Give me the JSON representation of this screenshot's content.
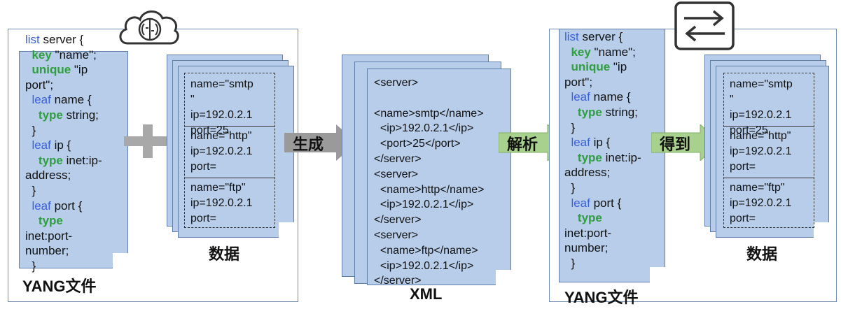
{
  "left_yang": {
    "lines": [
      [
        {
          "t": "list",
          "c": "blue"
        },
        {
          "t": " server {",
          "c": ""
        }
      ],
      [
        {
          "t": "  ",
          "c": ""
        },
        {
          "t": "key",
          "c": "green"
        },
        {
          "t": " \"name\";",
          "c": ""
        }
      ],
      [
        {
          "t": "  ",
          "c": ""
        },
        {
          "t": "unique",
          "c": "green"
        },
        {
          "t": " \"ip",
          "c": ""
        }
      ],
      [
        {
          "t": "port\";",
          "c": ""
        }
      ],
      [
        {
          "t": "  ",
          "c": ""
        },
        {
          "t": "leaf",
          "c": "blue"
        },
        {
          "t": " name {",
          "c": ""
        }
      ],
      [
        {
          "t": "    ",
          "c": ""
        },
        {
          "t": "type",
          "c": "green"
        },
        {
          "t": " string;",
          "c": ""
        }
      ],
      [
        {
          "t": "  }",
          "c": ""
        }
      ],
      [
        {
          "t": "  ",
          "c": ""
        },
        {
          "t": "leaf",
          "c": "blue"
        },
        {
          "t": " ip {",
          "c": ""
        }
      ],
      [
        {
          "t": "    ",
          "c": ""
        },
        {
          "t": "type",
          "c": "green"
        },
        {
          "t": " inet:ip-",
          "c": ""
        }
      ],
      [
        {
          "t": "address;",
          "c": ""
        }
      ],
      [
        {
          "t": "  }",
          "c": ""
        }
      ],
      [
        {
          "t": "  ",
          "c": ""
        },
        {
          "t": "leaf",
          "c": "blue"
        },
        {
          "t": " port {",
          "c": ""
        }
      ],
      [
        {
          "t": "    ",
          "c": ""
        },
        {
          "t": "type",
          "c": "green"
        }
      ],
      [
        {
          "t": "inet:port-",
          "c": ""
        }
      ],
      [
        {
          "t": "number;",
          "c": ""
        }
      ],
      [
        {
          "t": "  }",
          "c": ""
        }
      ]
    ],
    "caption": "YANG文件"
  },
  "right_yang": {
    "lines": [
      [
        {
          "t": "list",
          "c": "blue"
        },
        {
          "t": " server {",
          "c": ""
        }
      ],
      [
        {
          "t": "  ",
          "c": ""
        },
        {
          "t": "key",
          "c": "green"
        },
        {
          "t": " \"name\";",
          "c": ""
        }
      ],
      [
        {
          "t": "  ",
          "c": ""
        },
        {
          "t": "unique",
          "c": "green"
        },
        {
          "t": " \"ip",
          "c": ""
        }
      ],
      [
        {
          "t": "port\";",
          "c": ""
        }
      ],
      [
        {
          "t": "  ",
          "c": ""
        },
        {
          "t": "leaf",
          "c": "blue"
        },
        {
          "t": " name {",
          "c": ""
        }
      ],
      [
        {
          "t": "    ",
          "c": ""
        },
        {
          "t": "type",
          "c": "green"
        },
        {
          "t": " string;",
          "c": ""
        }
      ],
      [
        {
          "t": "  }",
          "c": ""
        }
      ],
      [
        {
          "t": "  ",
          "c": ""
        },
        {
          "t": "leaf",
          "c": "blue"
        },
        {
          "t": " ip {",
          "c": ""
        }
      ],
      [
        {
          "t": "    ",
          "c": ""
        },
        {
          "t": "type",
          "c": "green"
        },
        {
          "t": " inet:ip-",
          "c": ""
        }
      ],
      [
        {
          "t": "address;",
          "c": ""
        }
      ],
      [
        {
          "t": "  }",
          "c": ""
        }
      ],
      [
        {
          "t": "  ",
          "c": ""
        },
        {
          "t": "leaf",
          "c": "blue"
        },
        {
          "t": " port {",
          "c": ""
        }
      ],
      [
        {
          "t": "    ",
          "c": ""
        },
        {
          "t": "type",
          "c": "green"
        }
      ],
      [
        {
          "t": "inet:port-",
          "c": ""
        }
      ],
      [
        {
          "t": "number;",
          "c": ""
        }
      ],
      [
        {
          "t": "  }",
          "c": ""
        }
      ]
    ],
    "caption": "YANG文件"
  },
  "data_block": {
    "rec1": "name=\"smtp\n\"\nip=192.0.2.1\nport=25",
    "rec2": "name=\"http\"\nip=192.0.2.1\nport=",
    "rec3": "name=\"ftp\"\nip=192.0.2.1\nport=",
    "caption": "数据"
  },
  "xml": {
    "text": "<server>\n\n<name>smtp</name>\n  <ip>192.0.2.1</ip>\n  <port>25</port>\n</server>\n<server>\n  <name>http</name>\n  <ip>192.0.2.1</ip>\n</server>\n<server>\n  <name>ftp</name>\n  <ip>192.0.2.1</ip>\n</server>",
    "caption": "XML"
  },
  "arrows": {
    "generate": "生成",
    "parse": "解析",
    "obtain": "得到"
  },
  "icons": {
    "left": "brain-cloud-icon",
    "right": "exchange-arrows-icon"
  },
  "colors": {
    "doc_fill": "#b7cdea",
    "keyword_blue": "#3a62d8",
    "keyword_green": "#2f9e3e",
    "arrow_gray": "#9a9a9a",
    "arrow_green": "#a9d18e"
  }
}
